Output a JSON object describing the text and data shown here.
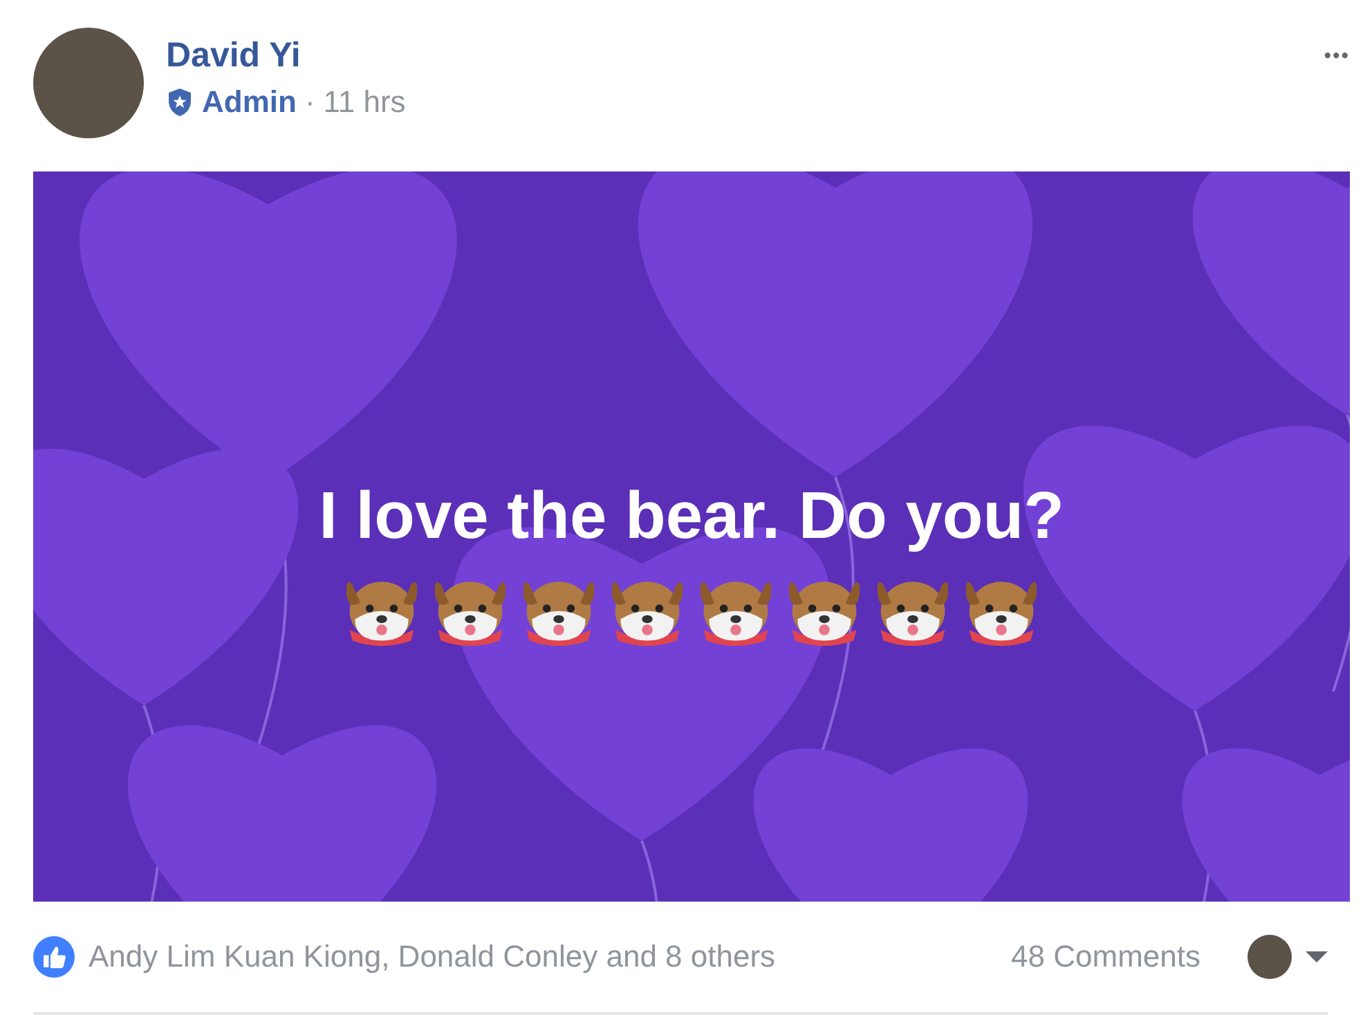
{
  "post": {
    "author": "David Yi",
    "role": "Admin",
    "separator": "·",
    "time": "11 hrs",
    "more": "•••"
  },
  "card": {
    "text": "I love the bear. Do you?",
    "emojis": [
      {
        "kind": "dog"
      },
      {
        "kind": "dog"
      },
      {
        "kind": "dog"
      },
      {
        "kind": "dog"
      },
      {
        "kind": "dog"
      },
      {
        "kind": "dog"
      },
      {
        "kind": "dog"
      },
      {
        "kind": "dog"
      }
    ]
  },
  "footer": {
    "likes": "Andy Lim Kuan Kiong, Donald Conley and 8 others",
    "comments": "48 Comments"
  }
}
